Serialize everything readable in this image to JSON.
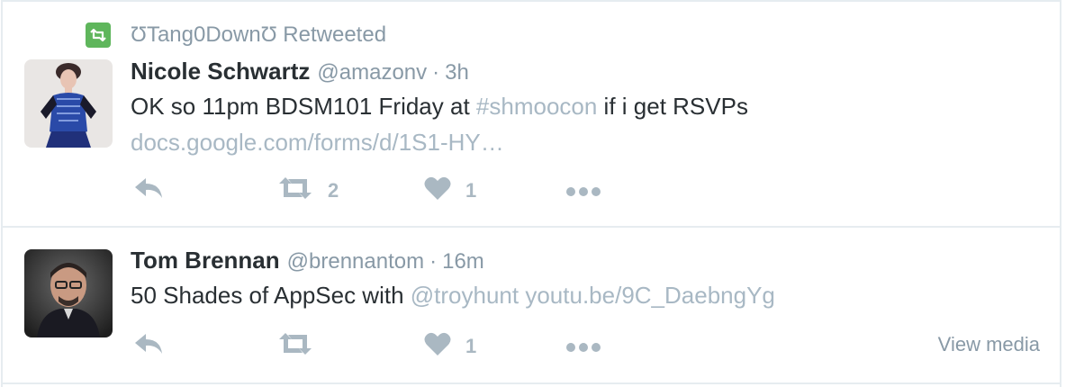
{
  "colors": {
    "text": "#292f33",
    "muted": "#8899a6",
    "link": "#a8b8c4",
    "retweet_badge": "#5fb65c",
    "action_icon": "#aab8c2",
    "divider": "#e6ecf0"
  },
  "tweets": [
    {
      "context": {
        "icon": "retweet-badge-icon",
        "text": "ƱTang0DownƱ Retweeted"
      },
      "author": {
        "name": "Nicole Schwartz",
        "handle": "@amazonv",
        "separator": "·",
        "time": "3h"
      },
      "text_parts": {
        "before": "OK so 11pm BDSM101 Friday at ",
        "hashtag": "#shmoocon",
        "after": " if i get RSVPs"
      },
      "link": "docs.google.com/forms/d/1S1-HY…",
      "actions": {
        "reply_icon": "reply-icon",
        "retweet_icon": "retweet-icon",
        "retweet_count": "2",
        "like_icon": "heart-icon",
        "like_count": "1",
        "more_icon": "more-icon"
      }
    },
    {
      "author": {
        "name": "Tom Brennan",
        "handle": "@brennantom",
        "separator": "·",
        "time": "16m"
      },
      "text_parts": {
        "before": "50 Shades of AppSec with ",
        "mention": "@troyhunt",
        "link": " youtu.be/9C_DaebngYg"
      },
      "actions": {
        "reply_icon": "reply-icon",
        "retweet_icon": "retweet-icon",
        "retweet_count": "",
        "like_icon": "heart-icon",
        "like_count": "1",
        "more_icon": "more-icon"
      },
      "view_media": "View media"
    }
  ]
}
